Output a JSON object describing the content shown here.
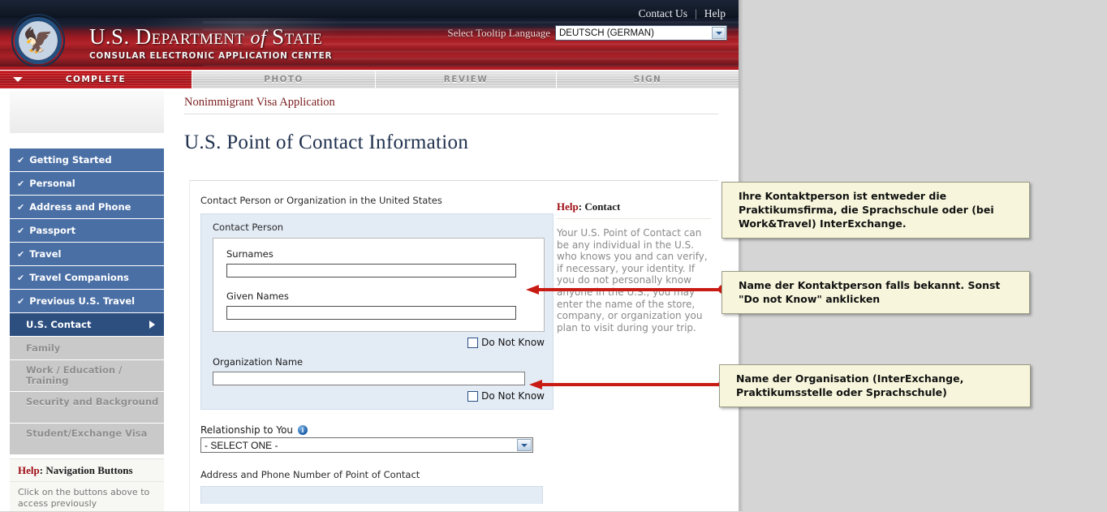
{
  "header": {
    "brand_line1_a": "U.S. D",
    "brand_line1": "U.S. Department of State",
    "brand_pre": "U.S. Department",
    "brand_of": "of",
    "brand_post": "State",
    "brand_line2": "CONSULAR ELECTRONIC APPLICATION CENTER",
    "contact_us": "Contact Us",
    "help": "Help",
    "separator": "|",
    "language_label": "Select Tooltip Language",
    "language_value": "DEUTSCH (GERMAN)"
  },
  "tabs": [
    {
      "label": "COMPLETE",
      "active": true
    },
    {
      "label": "PHOTO",
      "active": false
    },
    {
      "label": "REVIEW",
      "active": false
    },
    {
      "label": "SIGN",
      "active": false
    }
  ],
  "sidebar": {
    "items": [
      {
        "label": "Getting Started",
        "state": "done"
      },
      {
        "label": "Personal",
        "state": "done"
      },
      {
        "label": "Address and Phone",
        "state": "done"
      },
      {
        "label": "Passport",
        "state": "done"
      },
      {
        "label": "Travel",
        "state": "done"
      },
      {
        "label": "Travel Companions",
        "state": "done"
      },
      {
        "label": "Previous U.S. Travel",
        "state": "done"
      },
      {
        "label": "U.S. Contact",
        "state": "current"
      },
      {
        "label": "Family",
        "state": "disabled"
      },
      {
        "label": "Work / Education / Training",
        "state": "disabled"
      },
      {
        "label": "Security and Background",
        "state": "disabled"
      },
      {
        "label": "Student/Exchange Visa",
        "state": "disabled"
      }
    ],
    "check_glyph": "✔",
    "help": {
      "title_kw": "Help",
      "title_rest": ": Navigation Buttons",
      "body": "Click on the buttons above to access previously"
    }
  },
  "main": {
    "breadcrumb": "Nonimmigrant Visa Application",
    "page_title": "U.S. Point of Contact Information",
    "section_label": "Contact Person or Organization in the United States",
    "contact_person_label": "Contact Person",
    "surnames_label": "Surnames",
    "surnames_value": "",
    "given_names_label": "Given Names",
    "given_names_value": "",
    "do_not_know_1": "Do Not Know",
    "organization_label": "Organization Name",
    "organization_value": "",
    "do_not_know_2": "Do Not Know",
    "relationship_label": "Relationship to You",
    "relationship_value": "- SELECT ONE -",
    "info_glyph": "i",
    "address_section_label": "Address and Phone Number of Point of Contact"
  },
  "help_panel": {
    "title_kw": "Help",
    "title_rest": ": Contact",
    "body": "Your U.S. Point of Contact can be any individual in the U.S. who knows you and can verify, if necessary, your identity. If you do not personally know anyone in the U.S., you may enter the name of the store, company, or organization you plan to visit during your trip."
  },
  "annotations": [
    {
      "text": "Ihre Kontaktperson ist entweder die Praktikumsfirma, die Sprachschule oder (bei Work&Travel) InterExchange."
    },
    {
      "text": "Name der Kontaktperson falls bekannt. Sonst \"Do not Know\" anklicken"
    },
    {
      "text": "Name der Organisation (InterExchange, Praktikumsstelle oder Sprachschule)"
    }
  ],
  "colors": {
    "brand_red": "#b11b22",
    "nav_blue": "#4a6fa5",
    "nav_current": "#2d4f80",
    "annotation_bg": "#f7f6dc",
    "arrow_red": "#c81b13",
    "field_blue": "#e3ebf5"
  }
}
